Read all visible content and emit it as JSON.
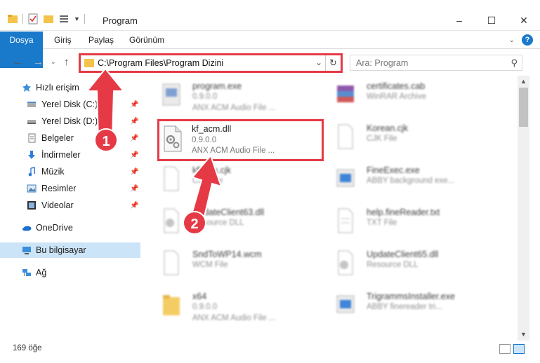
{
  "window": {
    "title": "Program",
    "controls": [
      "–",
      "☐",
      "✕"
    ]
  },
  "ribbon": {
    "tabs": [
      "Dosya",
      "Giriş",
      "Paylaş",
      "Görünüm"
    ],
    "help": "?"
  },
  "address": {
    "path": "C:\\Program Files\\Program Dizini"
  },
  "search": {
    "placeholder": "Ara: Program"
  },
  "sidebar": {
    "items": [
      {
        "label": "Hızlı erişim",
        "icon": "star-icon"
      },
      {
        "label": "Yerel Disk (C:)",
        "icon": "drive-icon",
        "pinned": true
      },
      {
        "label": "Yerel Disk (D:)",
        "icon": "drive-icon",
        "pinned": true
      },
      {
        "label": "Belgeler",
        "icon": "documents-icon",
        "pinned": true
      },
      {
        "label": "İndirmeler",
        "icon": "download-icon",
        "pinned": true
      },
      {
        "label": "Müzik",
        "icon": "music-icon",
        "pinned": true
      },
      {
        "label": "Resimler",
        "icon": "pictures-icon",
        "pinned": true
      },
      {
        "label": "Videolar",
        "icon": "videos-icon",
        "pinned": true
      },
      {
        "label": "OneDrive",
        "icon": "onedrive-icon"
      },
      {
        "label": "Bu bilgisayar",
        "icon": "computer-icon",
        "selected": true
      },
      {
        "label": "Ağ",
        "icon": "network-icon"
      }
    ]
  },
  "files": {
    "left": [
      {
        "name": "program.exe",
        "line2": "0.9.0.0",
        "line3": "ANX ACM Audio File ..."
      },
      {
        "name": "kf_acm.dll",
        "line2": "0.9.0.0",
        "line3": "ANX ACM Audio File ..."
      },
      {
        "name": "kfKorn.cjk",
        "line2": "CJK File",
        "line3": ""
      },
      {
        "name": "UpdateClient63.dll",
        "line2": "Resource DLL",
        "line3": ""
      },
      {
        "name": "SndToWP14.wcm",
        "line2": "WCM File",
        "line3": ""
      },
      {
        "name": "x64",
        "line2": "0.9.0.0",
        "line3": "ANX ACM Audio File ..."
      }
    ],
    "right": [
      {
        "name": "certificates.cab",
        "line2": "WinRAR Archive"
      },
      {
        "name": "Korean.cjk",
        "line2": "CJK File"
      },
      {
        "name": "FineExec.exe",
        "line2": "ABBY background exe..."
      },
      {
        "name": "help.fineReader.txt",
        "line2": "TXT File"
      },
      {
        "name": "UpdateClient65.dll",
        "line2": "Resource DLL"
      },
      {
        "name": "TrigrammsInstaller.exe",
        "line2": "ABBY finereader tri..."
      }
    ]
  },
  "status": {
    "count": "169 öğe"
  },
  "markers": {
    "one": "1",
    "two": "2"
  },
  "colors": {
    "accent": "#1979ca",
    "highlight": "#e53a45",
    "selected": "#cce4f7"
  }
}
